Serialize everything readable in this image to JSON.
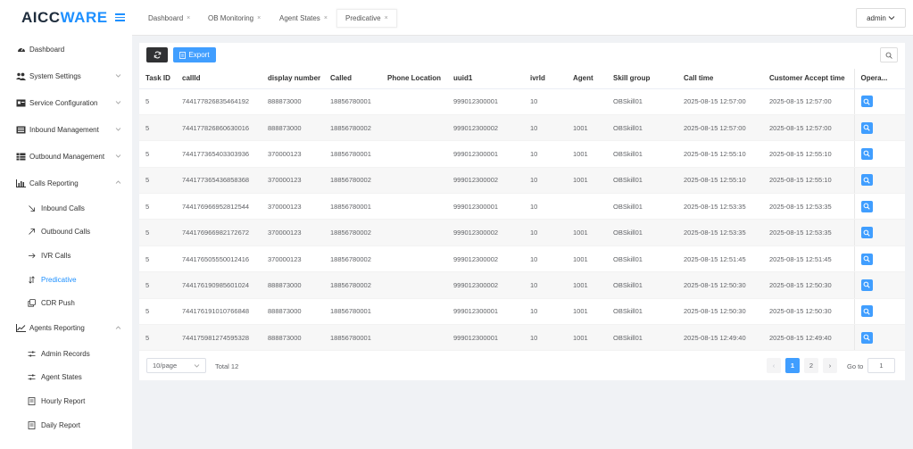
{
  "brand": {
    "logo_main": "AICC",
    "logo_accent": "WARE"
  },
  "sidebar": {
    "items": [
      {
        "label": "Dashboard",
        "icon": "dashboard-icon"
      },
      {
        "label": "System Settings",
        "icon": "users-icon",
        "chevron": "down"
      },
      {
        "label": "Service Configuration",
        "icon": "card-icon",
        "chevron": "down"
      },
      {
        "label": "Inbound Management",
        "icon": "list-icon",
        "chevron": "down"
      },
      {
        "label": "Outbound Management",
        "icon": "grid-icon",
        "chevron": "down"
      },
      {
        "label": "Calls Reporting",
        "icon": "bar-chart-icon",
        "chevron": "up"
      }
    ],
    "calls_sub": [
      {
        "label": "Inbound Calls",
        "icon": "arrow-down-right-icon"
      },
      {
        "label": "Outbound Calls",
        "icon": "arrow-up-right-icon"
      },
      {
        "label": "IVR Calls",
        "icon": "arrow-right-icon"
      },
      {
        "label": "Predicative",
        "icon": "swap-icon",
        "active": true
      },
      {
        "label": "CDR Push",
        "icon": "copy-icon"
      }
    ],
    "agents_reporting": {
      "label": "Agents Reporting",
      "icon": "line-chart-icon",
      "chevron": "up"
    },
    "agents_sub": [
      {
        "label": "Admin Records",
        "icon": "sliders-icon"
      },
      {
        "label": "Agent States",
        "icon": "sliders-icon"
      },
      {
        "label": "Hourly Report",
        "icon": "document-icon"
      },
      {
        "label": "Daily Report",
        "icon": "document-icon"
      }
    ]
  },
  "tabs": [
    {
      "label": "Dashboard",
      "close": "×"
    },
    {
      "label": "OB Monitoring",
      "close": "×"
    },
    {
      "label": "Agent States",
      "close": "×"
    },
    {
      "label": "Predicative",
      "close": "×",
      "active": true
    }
  ],
  "user": {
    "name": "admin"
  },
  "toolbar": {
    "export_label": "Export"
  },
  "table": {
    "columns": [
      "Task ID",
      "callId",
      "display number",
      "Called",
      "Phone Location",
      "uuid1",
      "ivrId",
      "Agent",
      "Skill group",
      "Call time",
      "Customer Accept time",
      "Opera..."
    ],
    "rows": [
      [
        "5",
        "744177826835464192",
        "888873000",
        "18856780001",
        "",
        "999012300001",
        "10",
        "",
        "OBSkill01",
        "2025-08-15 12:57:00",
        "2025-08-15 12:57:00"
      ],
      [
        "5",
        "744177826860630016",
        "888873000",
        "18856780002",
        "",
        "999012300002",
        "10",
        "1001",
        "OBSkill01",
        "2025-08-15 12:57:00",
        "2025-08-15 12:57:00"
      ],
      [
        "5",
        "744177365403303936",
        "370000123",
        "18856780001",
        "",
        "999012300001",
        "10",
        "1001",
        "OBSkill01",
        "2025-08-15 12:55:10",
        "2025-08-15 12:55:10"
      ],
      [
        "5",
        "744177365436858368",
        "370000123",
        "18856780002",
        "",
        "999012300002",
        "10",
        "1001",
        "OBSkill01",
        "2025-08-15 12:55:10",
        "2025-08-15 12:55:10"
      ],
      [
        "5",
        "744176966952812544",
        "370000123",
        "18856780001",
        "",
        "999012300001",
        "10",
        "",
        "OBSkill01",
        "2025-08-15 12:53:35",
        "2025-08-15 12:53:35"
      ],
      [
        "5",
        "744176966982172672",
        "370000123",
        "18856780002",
        "",
        "999012300002",
        "10",
        "1001",
        "OBSkill01",
        "2025-08-15 12:53:35",
        "2025-08-15 12:53:35"
      ],
      [
        "5",
        "744176505550012416",
        "370000123",
        "18856780002",
        "",
        "999012300002",
        "10",
        "1001",
        "OBSkill01",
        "2025-08-15 12:51:45",
        "2025-08-15 12:51:45"
      ],
      [
        "5",
        "744176190985601024",
        "888873000",
        "18856780002",
        "",
        "999012300002",
        "10",
        "1001",
        "OBSkill01",
        "2025-08-15 12:50:30",
        "2025-08-15 12:50:30"
      ],
      [
        "5",
        "744176191010766848",
        "888873000",
        "18856780001",
        "",
        "999012300001",
        "10",
        "1001",
        "OBSkill01",
        "2025-08-15 12:50:30",
        "2025-08-15 12:50:30"
      ],
      [
        "5",
        "744175981274595328",
        "888873000",
        "18856780001",
        "",
        "999012300001",
        "10",
        "1001",
        "OBSkill01",
        "2025-08-15 12:49:40",
        "2025-08-15 12:49:40"
      ]
    ]
  },
  "pagination": {
    "page_size": "10/page",
    "total": "Total 12",
    "pages": [
      "1",
      "2"
    ],
    "current": "1",
    "goto_label": "Go to",
    "goto_value": "1",
    "prev": "‹",
    "next": "›"
  },
  "colors": {
    "accent": "#409eff",
    "brand_blue": "#1e90ff",
    "dark_button": "#303133"
  }
}
